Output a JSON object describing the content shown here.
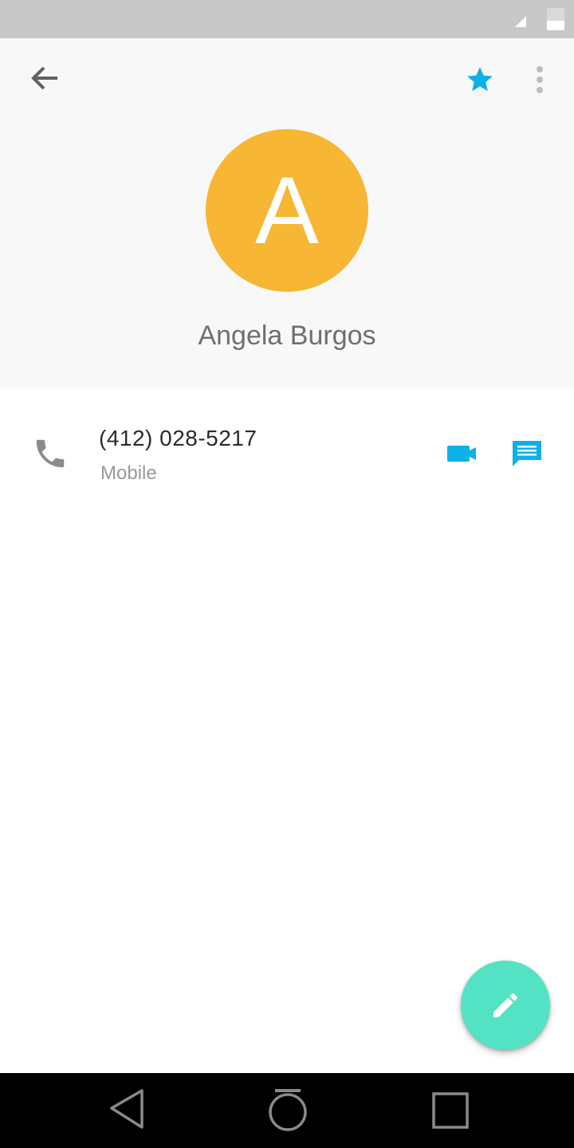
{
  "status_bar": {
    "icons": [
      "signal-icon",
      "battery-icon"
    ]
  },
  "toolbar": {
    "back_icon": "arrow-back-icon",
    "favorite_icon": "star-icon",
    "more_icon": "more-vert-icon"
  },
  "contact": {
    "initial": "A",
    "name": "Angela Burgos",
    "avatar_color": "#f7b633"
  },
  "phone": {
    "number": "(412) 028-5217",
    "type": "Mobile",
    "icons": [
      "phone-icon",
      "videocam-icon",
      "message-icon"
    ]
  },
  "fab": {
    "icon": "edit-pencil-icon",
    "color": "#53e3c4"
  },
  "nav_bar": {
    "icons": [
      "nav-back-icon",
      "nav-home-icon",
      "nav-recents-icon"
    ]
  },
  "colors": {
    "accent": "#0eb0e8",
    "status_bar": "#c8c8c8",
    "header_bg": "#f8f8f8",
    "nav_bar": "#000000"
  }
}
